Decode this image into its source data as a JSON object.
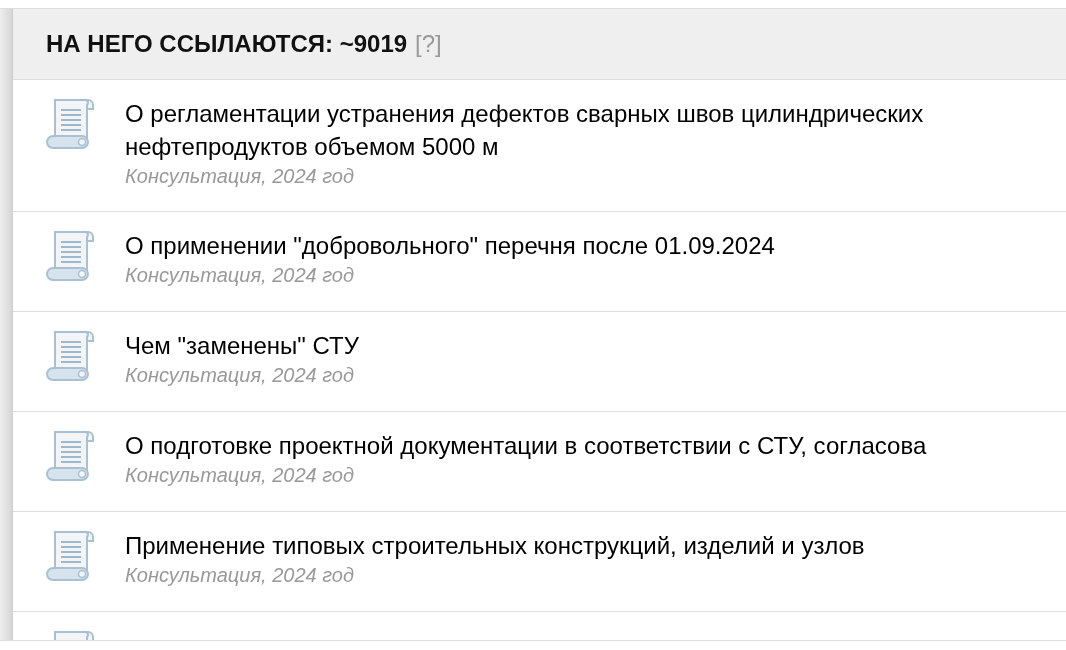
{
  "references": {
    "header": {
      "title": "НА НЕГО ССЫЛАЮТСЯ: ~9019",
      "help": "[?]"
    },
    "documents": [
      {
        "title_lines": [
          "О регламентации устранения дефектов сварных швов цилиндрических",
          "нефтепродуктов объемом 5000 м"
        ],
        "meta": "Консультация, 2024 год"
      },
      {
        "title_lines": [
          "О применении \"добровольного\" перечня после 01.09.2024"
        ],
        "meta": "Консультация, 2024 год"
      },
      {
        "title_lines": [
          "Чем \"заменены\" СТУ"
        ],
        "meta": "Консультация, 2024 год"
      },
      {
        "title_lines": [
          "О подготовке проектной документации в соответствии с СТУ, согласова"
        ],
        "meta": "Консультация, 2024 год"
      },
      {
        "title_lines": [
          "Применение типовых строительных конструкций, изделий и узлов"
        ],
        "meta": "Консультация, 2024 год"
      }
    ],
    "more_rows_below": true
  }
}
